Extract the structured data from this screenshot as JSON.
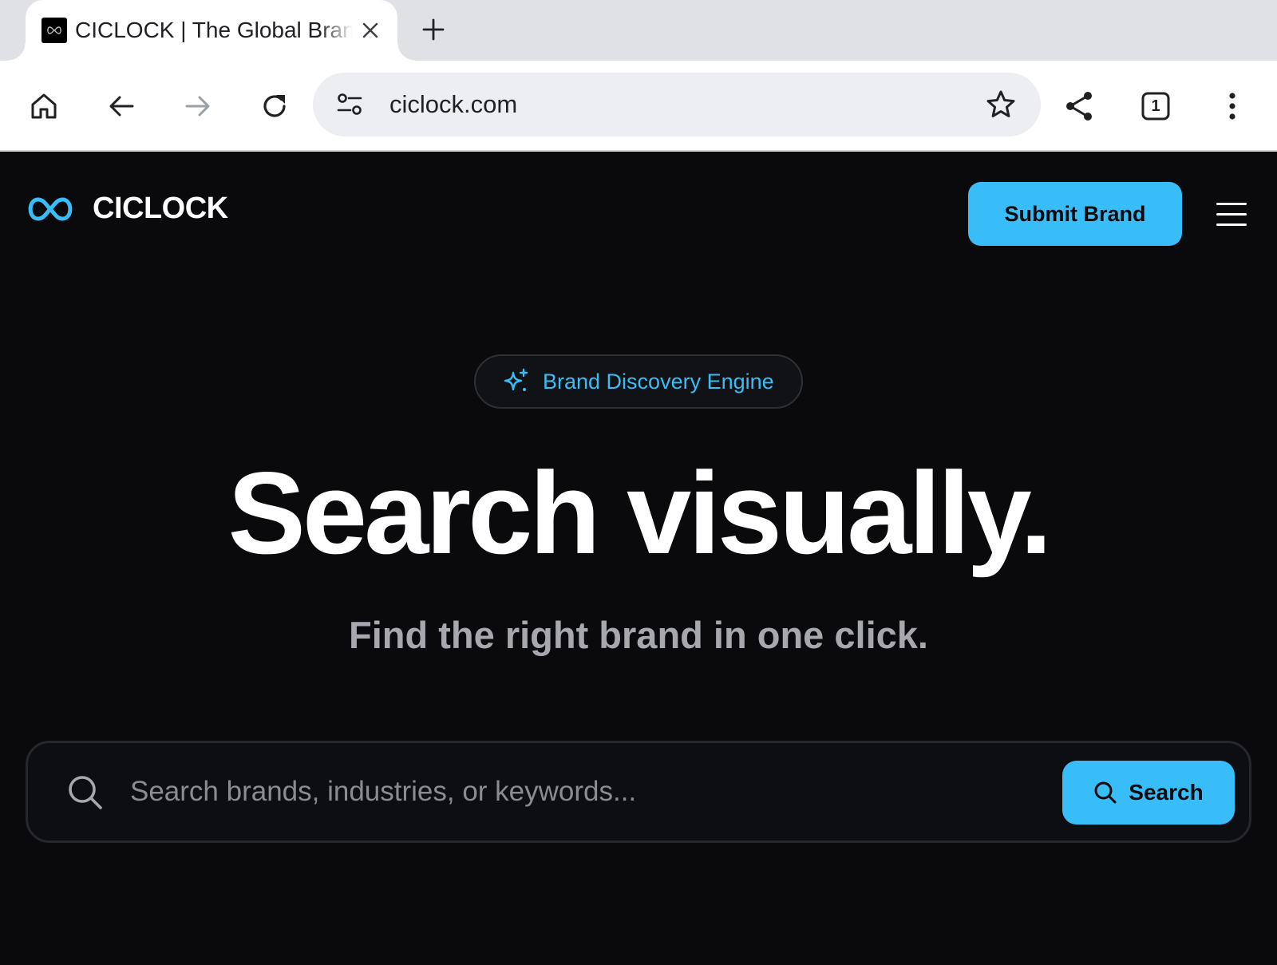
{
  "browser": {
    "tab_title": "CICLOCK | The Global Brand",
    "url": "ciclock.com",
    "tab_count": "1"
  },
  "header": {
    "brand_name": "CICLOCK",
    "submit_label": "Submit Brand"
  },
  "hero": {
    "badge": "Brand Discovery Engine",
    "title": "Search visually.",
    "subtitle": "Find the right brand in one click."
  },
  "search": {
    "placeholder": "Search brands, industries, or keywords...",
    "value": "",
    "button_label": "Search"
  },
  "colors": {
    "accent": "#38bdf8",
    "background": "#0a0a0c"
  },
  "icons": [
    "home-icon",
    "back-arrow-icon",
    "forward-arrow-icon",
    "reload-icon",
    "site-settings-icon",
    "star-icon",
    "share-icon",
    "tab-switcher-icon",
    "more-vert-icon",
    "infinity-logo-icon",
    "sparkle-icon",
    "search-icon",
    "hamburger-menu-icon",
    "close-icon",
    "plus-icon"
  ]
}
